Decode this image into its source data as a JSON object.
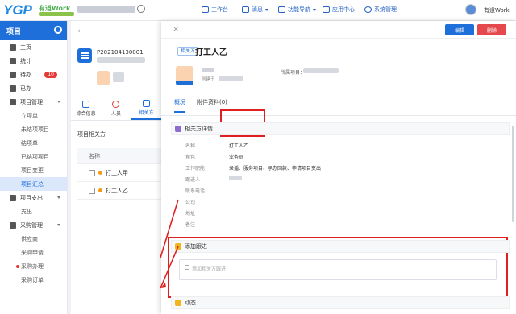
{
  "topbar": {
    "logo": "YGP",
    "logo_work": "有道Work",
    "nav": [
      "工作台",
      "消息",
      "功能导航",
      "应用中心",
      "系统管理"
    ],
    "user": "有道Work"
  },
  "sidebar": {
    "title": "项目",
    "items": [
      {
        "label": "主页",
        "type": "main"
      },
      {
        "label": "统计",
        "type": "main"
      },
      {
        "label": "待办",
        "type": "main",
        "badge": "10"
      },
      {
        "label": "已办",
        "type": "main"
      },
      {
        "label": "项目管理",
        "type": "group"
      },
      {
        "label": "立项单",
        "type": "sub"
      },
      {
        "label": "未结项项目",
        "type": "sub"
      },
      {
        "label": "结项单",
        "type": "sub"
      },
      {
        "label": "已结项项目",
        "type": "sub"
      },
      {
        "label": "项目变更",
        "type": "sub"
      },
      {
        "label": "项目汇总",
        "type": "sub",
        "active": true
      },
      {
        "label": "项目支出",
        "type": "group"
      },
      {
        "label": "支出",
        "type": "sub"
      },
      {
        "label": "采购管理",
        "type": "group"
      },
      {
        "label": "供应商",
        "type": "sub"
      },
      {
        "label": "采购申请",
        "type": "sub"
      },
      {
        "label": "采购办理",
        "type": "sub",
        "dot": true
      },
      {
        "label": "采购订单",
        "type": "sub"
      }
    ]
  },
  "middle": {
    "project_no": "P202104130001",
    "tabs": [
      "综合信息",
      "人员",
      "相关方"
    ],
    "section_title": "项目相关方",
    "table_header": "名称",
    "rows": [
      "打工人甲",
      "打工人乙"
    ]
  },
  "panel": {
    "edit_label": "编辑",
    "delete_label": "删除",
    "tag": "相关方",
    "title": "打工人乙",
    "created_label": "创建于",
    "project_label": "所属项目：",
    "tabs": [
      "概况",
      "附件资料(0)"
    ],
    "detail_title": "相关方详情",
    "fields": [
      {
        "label": "名称",
        "value": "打工人乙"
      },
      {
        "label": "角色",
        "value": "业务员"
      },
      {
        "label": "工作职能",
        "value": "录播、服务项目、承办回款、申请项目支出"
      },
      {
        "label": "跟进人",
        "value": ""
      },
      {
        "label": "联系电话",
        "value": ""
      },
      {
        "label": "公司",
        "value": ""
      },
      {
        "label": "地址",
        "value": ""
      },
      {
        "label": "备注",
        "value": ""
      }
    ],
    "followup_title": "添加跟进",
    "followup_placeholder": "添加相关方跟进",
    "activity_title": "动态"
  },
  "colors": {
    "primary": "#1e6fd9",
    "danger": "#e5484d",
    "highlight": "#e02020"
  }
}
